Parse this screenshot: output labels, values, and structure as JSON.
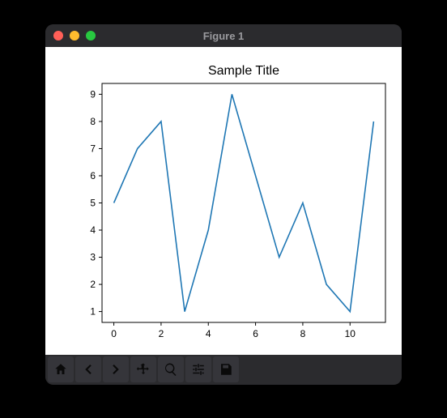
{
  "window": {
    "title": "Figure 1"
  },
  "chart_data": {
    "type": "line",
    "title": "Sample Title",
    "xlabel": "",
    "ylabel": "",
    "x": [
      0,
      1,
      2,
      3,
      4,
      5,
      6,
      7,
      8,
      9,
      10,
      11
    ],
    "values": [
      5,
      7,
      8,
      1,
      4,
      9,
      6,
      3,
      5,
      2,
      1,
      8
    ],
    "xlim": [
      -0.5,
      11.5
    ],
    "ylim": [
      0.6,
      9.4
    ],
    "xticks": [
      0,
      2,
      4,
      6,
      8,
      10
    ],
    "yticks": [
      1,
      2,
      3,
      4,
      5,
      6,
      7,
      8,
      9
    ]
  },
  "toolbar": {
    "home": "Home",
    "back": "Back",
    "forward": "Forward",
    "pan": "Pan",
    "zoom": "Zoom",
    "configure": "Configure subplots",
    "save": "Save"
  }
}
